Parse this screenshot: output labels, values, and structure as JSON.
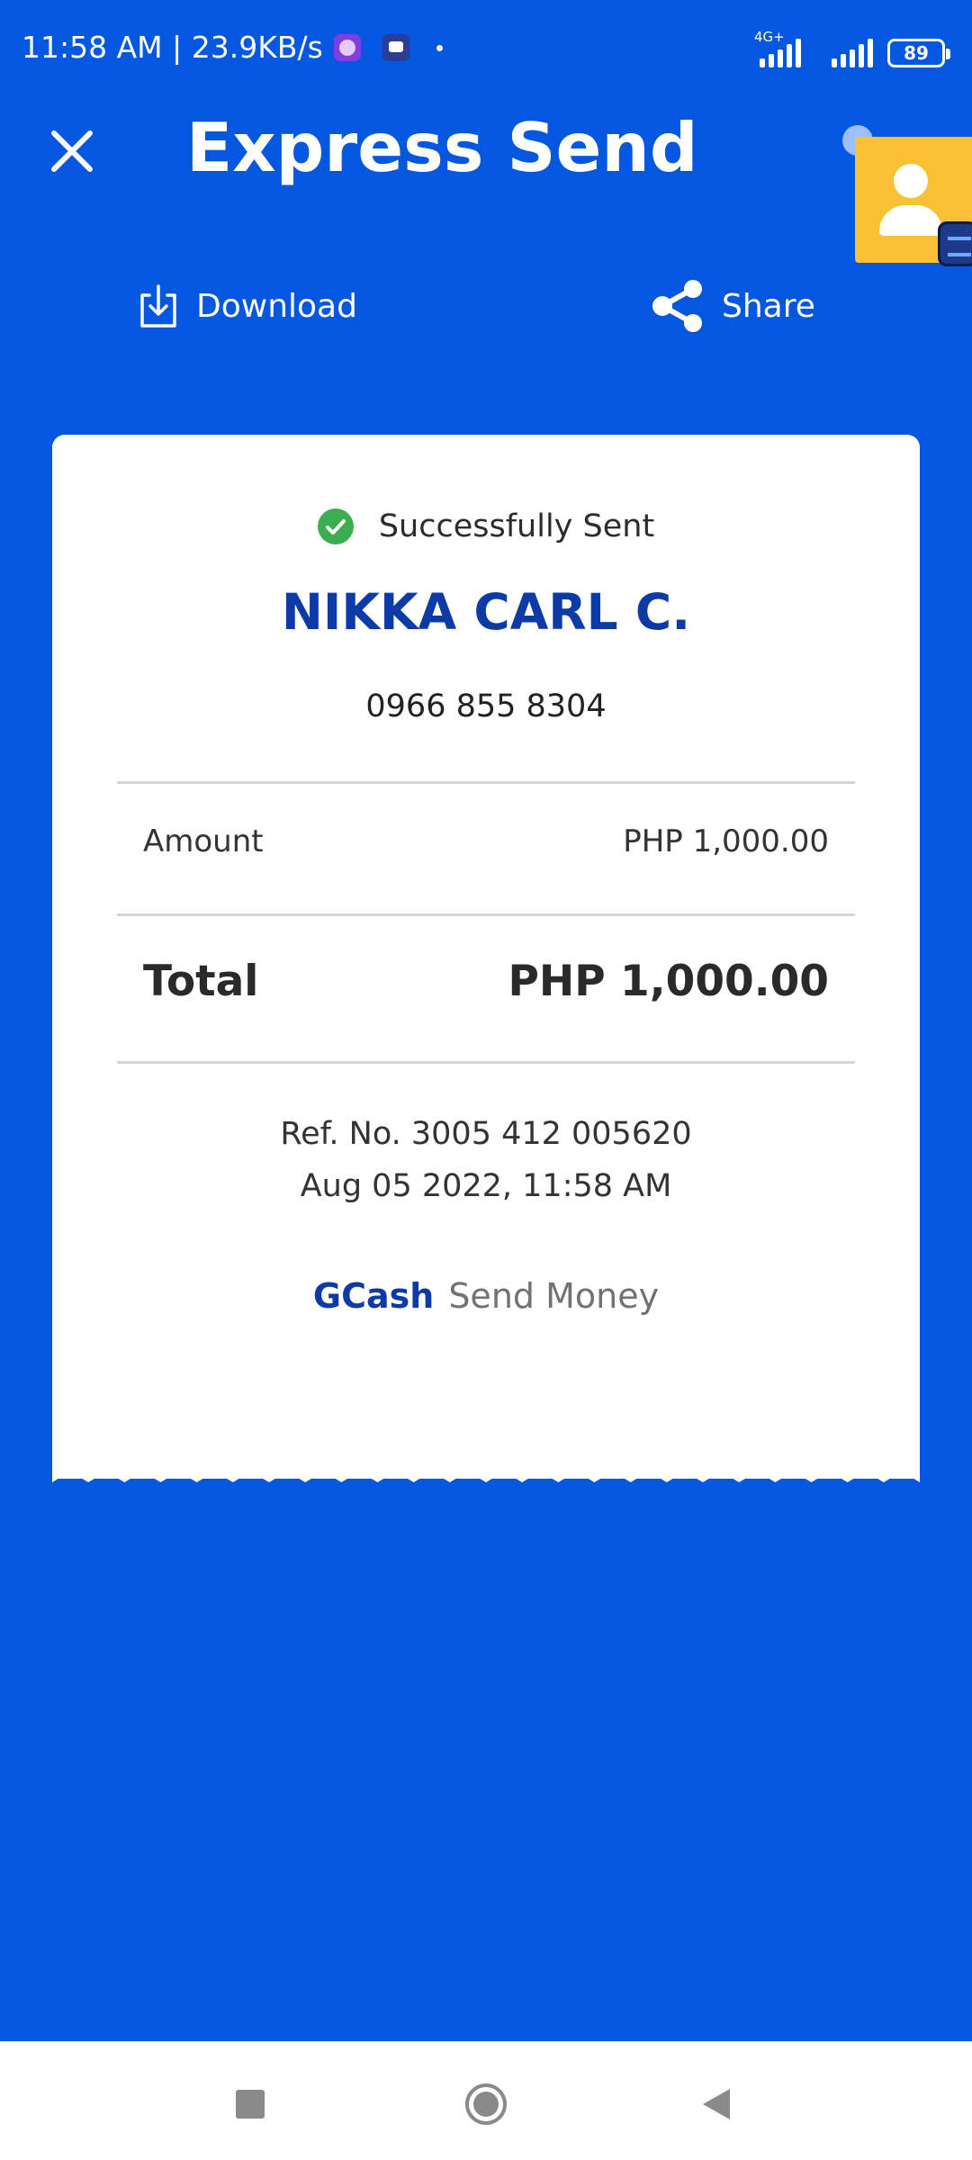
{
  "status_bar": {
    "time_speed": "11:58 AM | 23.9KB/s",
    "network_type": "4G+",
    "battery": "89"
  },
  "header": {
    "title": "Express Send"
  },
  "actions": {
    "download_label": "Download",
    "share_label": "Share"
  },
  "receipt": {
    "status": "Successfully Sent",
    "recipient_name": "NIKKA CARL C.",
    "recipient_number": "0966 855 8304",
    "amount_label": "Amount",
    "amount_value": "PHP 1,000.00",
    "total_label": "Total",
    "total_value": "PHP 1,000.00",
    "ref_no": "Ref. No. 3005 412 005620",
    "date_time": "Aug 05 2022, 11:58 AM",
    "brand_name": "GCash",
    "brand_service": "Send Money"
  },
  "colors": {
    "background": "#0457df",
    "brand_blue": "#0c3aa6",
    "success_green": "#3cae4f",
    "card": "#ffffff"
  },
  "icons": {
    "close": "close-icon",
    "download": "download-icon",
    "share": "share-icon",
    "success": "check-circle-icon",
    "contact_bubble": "person-icon"
  }
}
